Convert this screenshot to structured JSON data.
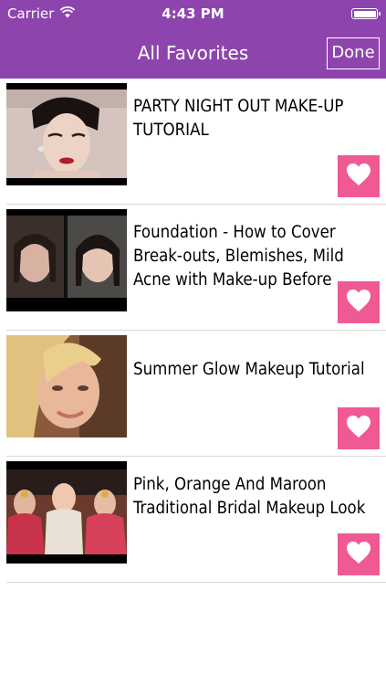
{
  "status": {
    "carrier": "Carrier",
    "time": "4:43 PM"
  },
  "nav": {
    "title": "All Favorites",
    "done_label": "Done"
  },
  "items": [
    {
      "title": "PARTY NIGHT OUT MAKE-UP TUTORIAL"
    },
    {
      "title": "Foundation - How to Cover Break-outs, Blemishes, Mild Acne with Make-up Before and…"
    },
    {
      "title": "Summer Glow Makeup Tutorial"
    },
    {
      "title": "Pink, Orange And Maroon Traditional Bridal Makeup Look"
    }
  ],
  "colors": {
    "header": "#8e44ad",
    "heart_button": "#f05a94"
  },
  "icons": {
    "favorite": "heart-icon"
  }
}
